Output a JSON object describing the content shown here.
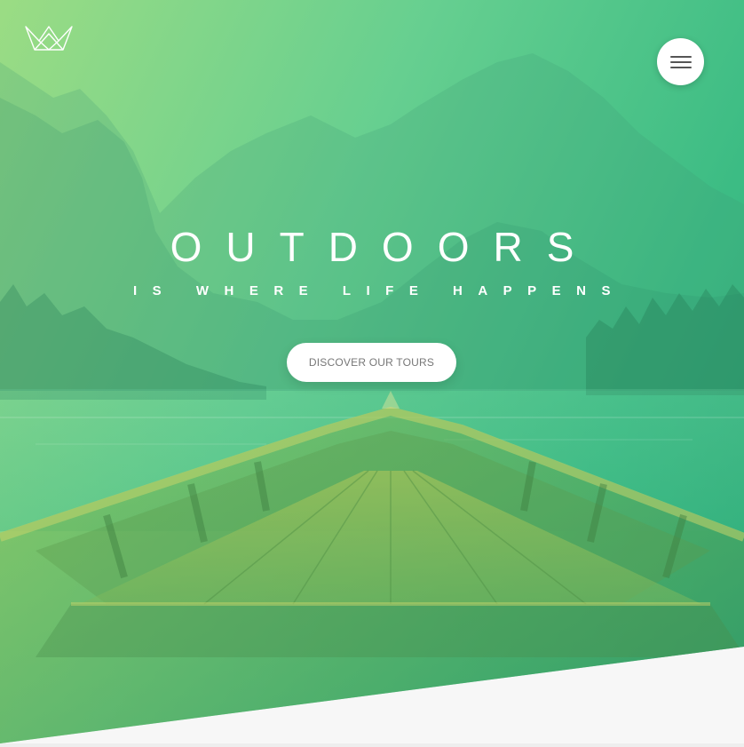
{
  "header": {
    "logo_icon": "crown-icon",
    "menu_icon": "hamburger-menu-icon"
  },
  "hero": {
    "title": "OUTDOORS",
    "subtitle": "IS WHERE LIFE HAPPENS",
    "cta_label": "DISCOVER OUR TOURS"
  },
  "colors": {
    "gradient_start": "#9bdc84",
    "gradient_end": "#2daa78",
    "button_bg": "#ffffff",
    "button_text": "#777777",
    "page_bg": "#f7f7f7"
  }
}
